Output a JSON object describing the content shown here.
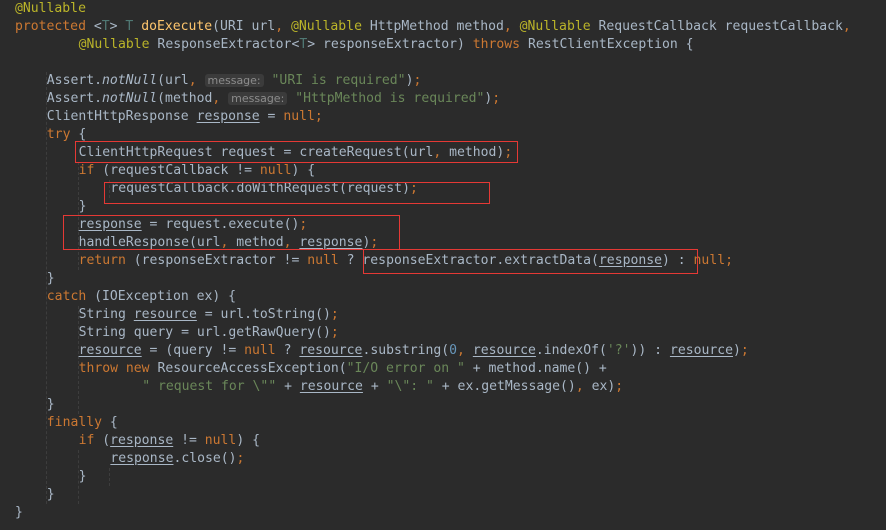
{
  "editor": {
    "lines": [
      {
        "indent": 0,
        "tokens": [
          {
            "t": "@Nullable",
            "c": "ann"
          }
        ]
      },
      {
        "indent": 0,
        "tokens": [
          {
            "t": "protected ",
            "c": "kw"
          },
          {
            "t": "<"
          },
          {
            "t": "T",
            "c": "tp"
          },
          {
            "t": "> "
          },
          {
            "t": "T",
            "c": "tp"
          },
          {
            "t": " "
          },
          {
            "t": "doExecute",
            "c": "fn"
          },
          {
            "t": "(URI url"
          },
          {
            "t": ", ",
            "c": "kw"
          },
          {
            "t": "@Nullable",
            "c": "ann"
          },
          {
            "t": " HttpMethod method"
          },
          {
            "t": ", ",
            "c": "kw"
          },
          {
            "t": "@Nullable",
            "c": "ann"
          },
          {
            "t": " RequestCallback requestCallback"
          },
          {
            "t": ",",
            "c": "kw"
          }
        ]
      },
      {
        "indent": 8,
        "tokens": [
          {
            "t": "@Nullable",
            "c": "ann"
          },
          {
            "t": " ResponseExtractor<"
          },
          {
            "t": "T",
            "c": "tp"
          },
          {
            "t": "> responseExtractor) "
          },
          {
            "t": "throws ",
            "c": "kw"
          },
          {
            "t": "RestClientException {"
          }
        ]
      },
      {
        "indent": 0,
        "tokens": []
      },
      {
        "indent": 4,
        "tokens": [
          {
            "t": "Assert."
          },
          {
            "t": "notNull",
            "c": "it"
          },
          {
            "t": "(url"
          },
          {
            "t": ", ",
            "c": "kw"
          },
          {
            "t": "message:",
            "c": "hint"
          },
          {
            "t": " "
          },
          {
            "t": "\"URI is required\"",
            "c": "str"
          },
          {
            "t": ")"
          },
          {
            "t": ";",
            "c": "kw"
          }
        ]
      },
      {
        "indent": 4,
        "tokens": [
          {
            "t": "Assert."
          },
          {
            "t": "notNull",
            "c": "it"
          },
          {
            "t": "(method"
          },
          {
            "t": ", ",
            "c": "kw"
          },
          {
            "t": "message:",
            "c": "hint"
          },
          {
            "t": " "
          },
          {
            "t": "\"HttpMethod is required\"",
            "c": "str"
          },
          {
            "t": ")"
          },
          {
            "t": ";",
            "c": "kw"
          }
        ]
      },
      {
        "indent": 4,
        "tokens": [
          {
            "t": "ClientHttpResponse "
          },
          {
            "t": "response",
            "c": "ul"
          },
          {
            "t": " = "
          },
          {
            "t": "null",
            "c": "kw"
          },
          {
            "t": ";",
            "c": "kw"
          }
        ]
      },
      {
        "indent": 4,
        "tokens": [
          {
            "t": "try ",
            "c": "kw"
          },
          {
            "t": "{"
          }
        ]
      },
      {
        "indent": 8,
        "tokens": [
          {
            "t": "ClientHttpRequest request = createRequest(url"
          },
          {
            "t": ", ",
            "c": "kw"
          },
          {
            "t": "method)"
          },
          {
            "t": ";",
            "c": "kw"
          }
        ]
      },
      {
        "indent": 8,
        "tokens": [
          {
            "t": "if ",
            "c": "kw"
          },
          {
            "t": "(requestCallback != "
          },
          {
            "t": "null",
            "c": "kw"
          },
          {
            "t": ") {"
          }
        ]
      },
      {
        "indent": 12,
        "tokens": [
          {
            "t": "requestCallback.doWithRequest(request)"
          },
          {
            "t": ";",
            "c": "kw"
          }
        ]
      },
      {
        "indent": 8,
        "tokens": [
          {
            "t": "}"
          }
        ]
      },
      {
        "indent": 8,
        "tokens": [
          {
            "t": "response",
            "c": "ul"
          },
          {
            "t": " = request.execute()"
          },
          {
            "t": ";",
            "c": "kw"
          }
        ]
      },
      {
        "indent": 8,
        "tokens": [
          {
            "t": "handleResponse(url"
          },
          {
            "t": ", ",
            "c": "kw"
          },
          {
            "t": "method"
          },
          {
            "t": ", ",
            "c": "kw"
          },
          {
            "t": "response",
            "c": "ul"
          },
          {
            "t": ")"
          },
          {
            "t": ";",
            "c": "kw"
          }
        ]
      },
      {
        "indent": 8,
        "tokens": [
          {
            "t": "return ",
            "c": "kw"
          },
          {
            "t": "(responseExtractor != "
          },
          {
            "t": "null",
            "c": "kw"
          },
          {
            "t": " ? responseExtractor.extractData("
          },
          {
            "t": "response",
            "c": "ul"
          },
          {
            "t": ") : "
          },
          {
            "t": "null",
            "c": "kw"
          },
          {
            "t": ";",
            "c": "kw"
          }
        ]
      },
      {
        "indent": 4,
        "tokens": [
          {
            "t": "}"
          }
        ]
      },
      {
        "indent": 4,
        "tokens": [
          {
            "t": "catch ",
            "c": "kw"
          },
          {
            "t": "(IOException ex) {"
          }
        ]
      },
      {
        "indent": 8,
        "tokens": [
          {
            "t": "String "
          },
          {
            "t": "resource",
            "c": "ul"
          },
          {
            "t": " = url.toString()"
          },
          {
            "t": ";",
            "c": "kw"
          }
        ]
      },
      {
        "indent": 8,
        "tokens": [
          {
            "t": "String query = url.getRawQuery()"
          },
          {
            "t": ";",
            "c": "kw"
          }
        ]
      },
      {
        "indent": 8,
        "tokens": [
          {
            "t": "resource",
            "c": "ul"
          },
          {
            "t": " = (query != "
          },
          {
            "t": "null",
            "c": "kw"
          },
          {
            "t": " ? "
          },
          {
            "t": "resource",
            "c": "ul"
          },
          {
            "t": ".substring("
          },
          {
            "t": "0",
            "c": "num"
          },
          {
            "t": ", ",
            "c": "kw"
          },
          {
            "t": "resource",
            "c": "ul"
          },
          {
            "t": ".indexOf("
          },
          {
            "t": "'?'",
            "c": "str"
          },
          {
            "t": ")) : "
          },
          {
            "t": "resource",
            "c": "ul"
          },
          {
            "t": ")"
          },
          {
            "t": ";",
            "c": "kw"
          }
        ]
      },
      {
        "indent": 8,
        "tokens": [
          {
            "t": "throw new ",
            "c": "kw"
          },
          {
            "t": "ResourceAccessException("
          },
          {
            "t": "\"I/O error on \"",
            "c": "str"
          },
          {
            "t": " + method.name() +"
          }
        ]
      },
      {
        "indent": 16,
        "tokens": [
          {
            "t": "\" request for \\\"\"",
            "c": "str"
          },
          {
            "t": " + "
          },
          {
            "t": "resource",
            "c": "ul"
          },
          {
            "t": " + "
          },
          {
            "t": "\"\\\": \"",
            "c": "str"
          },
          {
            "t": " + ex.getMessage()"
          },
          {
            "t": ", ",
            "c": "kw"
          },
          {
            "t": "ex)"
          },
          {
            "t": ";",
            "c": "kw"
          }
        ]
      },
      {
        "indent": 4,
        "tokens": [
          {
            "t": "}"
          }
        ]
      },
      {
        "indent": 4,
        "tokens": [
          {
            "t": "finally ",
            "c": "kw"
          },
          {
            "t": "{"
          }
        ]
      },
      {
        "indent": 8,
        "tokens": [
          {
            "t": "if ",
            "c": "kw"
          },
          {
            "t": "("
          },
          {
            "t": "response",
            "c": "ul"
          },
          {
            "t": " != "
          },
          {
            "t": "null",
            "c": "kw"
          },
          {
            "t": ") {"
          }
        ]
      },
      {
        "indent": 12,
        "tokens": [
          {
            "t": "response",
            "c": "ul"
          },
          {
            "t": ".close()"
          },
          {
            "t": ";",
            "c": "kw"
          }
        ]
      },
      {
        "indent": 8,
        "tokens": [
          {
            "t": "}"
          }
        ]
      },
      {
        "indent": 4,
        "tokens": [
          {
            "t": "}"
          }
        ]
      },
      {
        "indent": 0,
        "tokens": [
          {
            "t": "}"
          }
        ]
      }
    ]
  }
}
